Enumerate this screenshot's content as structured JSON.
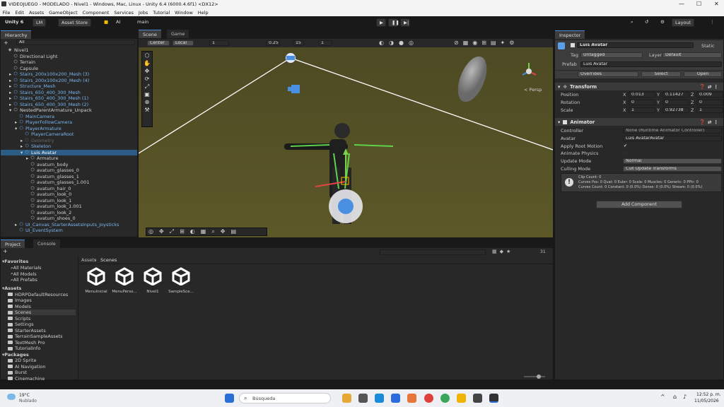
{
  "window": {
    "title": "VIDEOJUEGO - MODELADO - Nivel1 - Windows, Mac, Linux - Unity 6.4 (6000.4.6f1) <DX12>"
  },
  "menu": [
    "File",
    "Edit",
    "Assets",
    "GameObject",
    "Component",
    "Services",
    "Jobs",
    "Tutorial",
    "Window",
    "Help"
  ],
  "toolbar": {
    "unity": "Unity 6",
    "account": "LM",
    "asset_store": "Asset Store",
    "ai": "AI",
    "branch": "main",
    "layout": "Layout"
  },
  "hierarchy": {
    "tab": "Hierarchy",
    "search_placeholder": "All",
    "items": [
      {
        "label": "Nivel1",
        "depth": 0,
        "kind": "scene"
      },
      {
        "label": "Directional Light",
        "depth": 1,
        "kind": "obj"
      },
      {
        "label": "Terrain",
        "depth": 1,
        "kind": "obj"
      },
      {
        "label": "Capsule",
        "depth": 1,
        "kind": "obj"
      },
      {
        "label": "Stairs_200x100x200_Mesh (3)",
        "depth": 1,
        "kind": "prefab",
        "arrow": "▸"
      },
      {
        "label": "Stairs_200x100x200_Mesh (4)",
        "depth": 1,
        "kind": "prefab",
        "arrow": "▸"
      },
      {
        "label": "Structure_Mesh",
        "depth": 1,
        "kind": "prefab",
        "arrow": "▸"
      },
      {
        "label": "Stairs_650_400_300_Mesh",
        "depth": 1,
        "kind": "prefab",
        "arrow": "▸"
      },
      {
        "label": "Stairs_650_400_300_Mesh (1)",
        "depth": 1,
        "kind": "prefab",
        "arrow": "▸"
      },
      {
        "label": "Stairs_650_400_300_Mesh (2)",
        "depth": 1,
        "kind": "prefab",
        "arrow": "▸"
      },
      {
        "label": "NestedParentArmature_Unpack",
        "depth": 1,
        "kind": "obj",
        "arrow": "▾"
      },
      {
        "label": "MainCamera",
        "depth": 2,
        "kind": "prefab"
      },
      {
        "label": "PlayerFollowCamera",
        "depth": 2,
        "kind": "prefab",
        "arrow": "▸"
      },
      {
        "label": "PlayerArmature",
        "depth": 2,
        "kind": "prefab",
        "arrow": "▾"
      },
      {
        "label": "PlayerCameraRoot",
        "depth": 3,
        "kind": "prefab"
      },
      {
        "label": "Geometry",
        "depth": 3,
        "kind": "dim",
        "arrow": "▸"
      },
      {
        "label": "Skeleton",
        "depth": 3,
        "kind": "prefab",
        "arrow": "▸"
      },
      {
        "label": "Luis Avatar",
        "depth": 3,
        "kind": "selected",
        "arrow": "▾"
      },
      {
        "label": "Armature",
        "depth": 4,
        "kind": "obj",
        "arrow": "▸"
      },
      {
        "label": "avaturn_body",
        "depth": 4,
        "kind": "obj"
      },
      {
        "label": "avaturn_glasses_0",
        "depth": 4,
        "kind": "obj"
      },
      {
        "label": "avaturn_glasses_1",
        "depth": 4,
        "kind": "obj"
      },
      {
        "label": "avaturn_glasses_1.001",
        "depth": 4,
        "kind": "obj"
      },
      {
        "label": "avaturn_hair_0",
        "depth": 4,
        "kind": "obj"
      },
      {
        "label": "avaturn_look_0",
        "depth": 4,
        "kind": "obj"
      },
      {
        "label": "avaturn_look_1",
        "depth": 4,
        "kind": "obj"
      },
      {
        "label": "avaturn_look_1.001",
        "depth": 4,
        "kind": "obj"
      },
      {
        "label": "avaturn_look_2",
        "depth": 4,
        "kind": "obj"
      },
      {
        "label": "avaturn_shoes_0",
        "depth": 4,
        "kind": "obj"
      },
      {
        "label": "UI_Canvas_StarterAssetsInputs_Joysticks",
        "depth": 2,
        "kind": "prefab",
        "arrow": "▸"
      },
      {
        "label": "UI_EventSystem",
        "depth": 2,
        "kind": "prefab"
      }
    ]
  },
  "scene": {
    "tabs": [
      "Scene",
      "Game"
    ],
    "pivot": "Center",
    "space": "Local",
    "grid": "1",
    "snap": "0.25",
    "angle": "15",
    "scale": "1",
    "persp": "< Persp"
  },
  "inspector": {
    "tab": "Inspector",
    "object_name": "Luis Avatar",
    "static": "Static",
    "tag_label": "Tag",
    "tag": "Untagged",
    "layer_label": "Layer",
    "layer": "Default",
    "prefab_label": "Prefab",
    "prefab": "Luis Avatar",
    "overrides": "Overrides",
    "select": "Select",
    "open": "Open",
    "transform": {
      "title": "Transform",
      "rows": [
        {
          "label": "Position",
          "x": "0.013",
          "y": "0.11427",
          "z": "0.009"
        },
        {
          "label": "Rotation",
          "x": "0",
          "y": "0",
          "z": "0"
        },
        {
          "label": "Scale",
          "x": "1",
          "y": "0.92738",
          "z": "1"
        }
      ]
    },
    "animator": {
      "title": "Animator",
      "controller_label": "Controller",
      "controller": "None (Runtime Animator Controller)",
      "avatar_label": "Avatar",
      "avatar": "Luis AvatarAvatar",
      "apply_root_motion": "Apply Root Motion",
      "animate_physics": "Animate Physics",
      "update_mode_label": "Update Mode",
      "update_mode": "Normal",
      "culling_mode_label": "Culling Mode",
      "culling_mode": "Cull Update Transforms",
      "info": [
        "Clip Count: 0",
        "Curves Pos: 0 Quat: 0 Euler: 0 Scale: 0 Muscles: 0 Generic: 0 PPtr: 0",
        "Curves Count: 0 Constant: 0 (0.0%) Dense: 0 (0.0%) Stream: 0 (0.0%)"
      ]
    },
    "add_component": "Add Component"
  },
  "project": {
    "tabs": [
      "Project",
      "Console"
    ],
    "breadcrumb": [
      "Assets",
      "Scenes"
    ],
    "count": "31",
    "favorites": {
      "title": "Favorites",
      "items": [
        "All Materials",
        "All Models",
        "All Prefabs"
      ]
    },
    "assets": {
      "title": "Assets",
      "items": [
        "HDRPDefaultResources",
        "Images",
        "Models",
        "Scenes",
        "Scripts",
        "Settings",
        "StarterAssets",
        "TerrainSampleAssets",
        "TextMesh Pro",
        "TutorialInfo"
      ]
    },
    "packages": {
      "title": "Packages",
      "items": [
        "2D Sprite",
        "AI Navigation",
        "Burst",
        "Cinemachine"
      ]
    },
    "grid": [
      "MenuInicial",
      "MenuPerso...",
      "Nivel1",
      "SampleSce..."
    ]
  },
  "taskbar": {
    "temp": "19°C",
    "weather": "Nublado",
    "search": "Búsqueda",
    "time": "12:52 p. m.",
    "date": "11/05/2026"
  },
  "colors": {
    "accent": "#4a8ad8",
    "selection": "#2c5d87",
    "prefab": "#7bb6f0",
    "terrain": "#545023"
  }
}
